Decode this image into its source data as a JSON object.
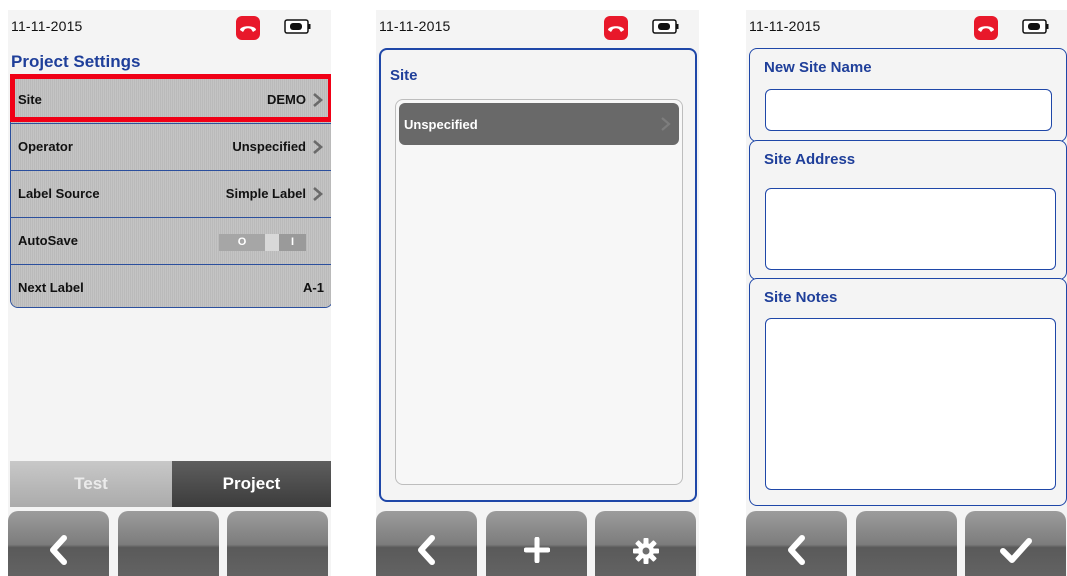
{
  "screens": [
    {
      "date": "11-11-2015",
      "title": "Project Settings",
      "settings": [
        {
          "label": "Site",
          "value": "DEMO"
        },
        {
          "label": "Operator",
          "value": "Unspecified"
        },
        {
          "label": "Label Source",
          "value": "Simple Label"
        },
        {
          "label": "AutoSave",
          "toggle_off": "O",
          "toggle_on": "I"
        },
        {
          "label": "Next Label",
          "value": "A-1"
        }
      ],
      "tabs": {
        "test": "Test",
        "project": "Project"
      },
      "softkeys": [
        "back-icon",
        "",
        ""
      ]
    },
    {
      "date": "11-11-2015",
      "title": "Site",
      "items": [
        {
          "label": "Unspecified"
        }
      ],
      "softkeys": [
        "back-icon",
        "plus-icon",
        "gear-icon"
      ]
    },
    {
      "date": "11-11-2015",
      "fields": [
        {
          "label": "New Site Name",
          "value": ""
        },
        {
          "label": "Site Address",
          "value": ""
        },
        {
          "label": "Site Notes",
          "value": ""
        }
      ],
      "softkeys": [
        "back-icon",
        "",
        "check-icon"
      ]
    }
  ],
  "colors": {
    "accent": "#1f3f9a",
    "border": "#1f47a8",
    "highlight": "#f00016",
    "hangup": "#e8182a",
    "selected_item": "#696969"
  }
}
